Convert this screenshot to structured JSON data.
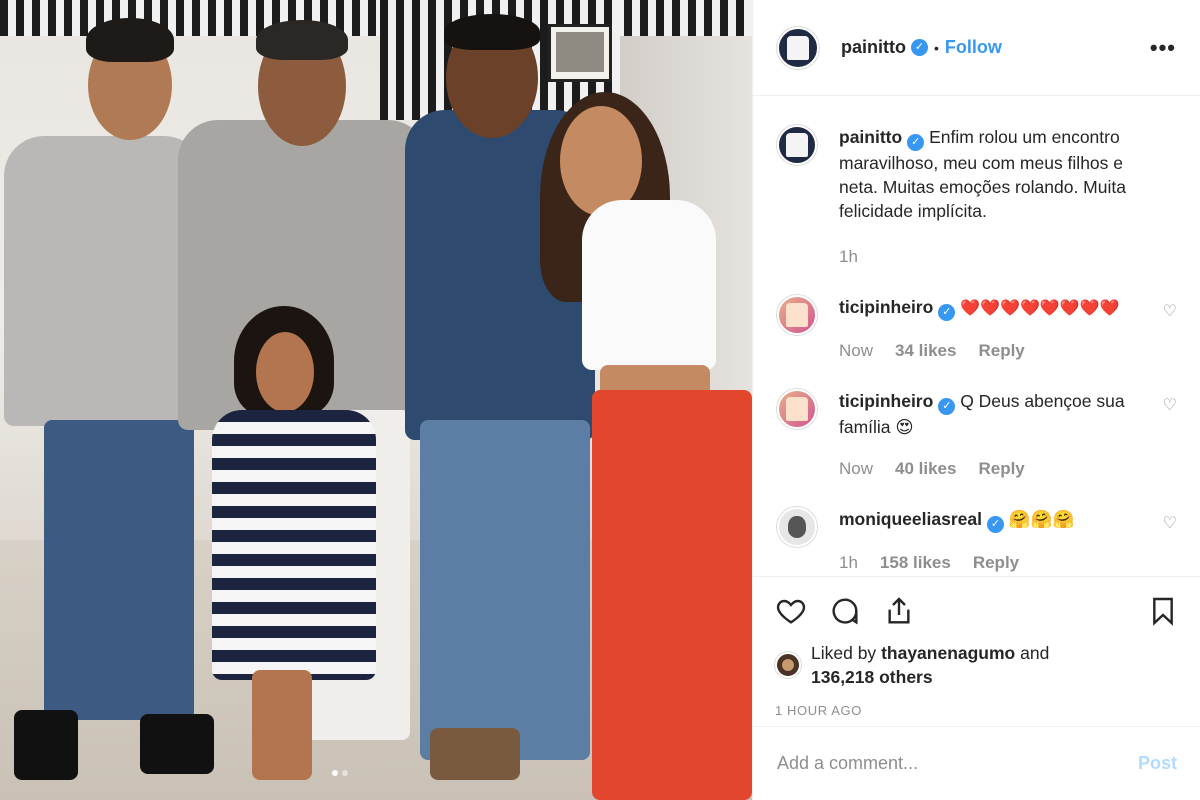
{
  "post": {
    "username": "painitto",
    "follow_label": "Follow",
    "bullet": "•",
    "more_label": "•••",
    "caption": "Enfim rolou um encontro maravilhoso, meu com meus filhos e neta. Muitas emoções rolando. Muita felicidade implícita.",
    "caption_time": "1h"
  },
  "comments": [
    {
      "username": "ticipinheiro",
      "text": "❤️❤️❤️❤️❤️❤️❤️❤️",
      "time": "Now",
      "likes": "34 likes",
      "reply": "Reply"
    },
    {
      "username": "ticipinheiro",
      "text": "Q Deus abençoe sua família 😍",
      "time": "Now",
      "likes": "40 likes",
      "reply": "Reply"
    },
    {
      "username": "moniqueeliasreal",
      "text": "🤗🤗🤗",
      "time": "1h",
      "likes": "158 likes",
      "reply": "Reply"
    }
  ],
  "likes": {
    "prefix": "Liked by",
    "user": "thayanenagumo",
    "connector": "and",
    "others": "136,218 others"
  },
  "timestamp": "1 HOUR AGO",
  "add_comment": {
    "placeholder": "Add a comment...",
    "post_label": "Post"
  },
  "colors": {
    "link_blue": "#3897f0",
    "post_disabled": "#b3dbff",
    "muted": "#8e8e8e",
    "text": "#262626"
  },
  "icons": [
    "heart-icon",
    "comment-icon",
    "share-icon",
    "bookmark-icon",
    "verified-badge-icon",
    "more-options-icon"
  ]
}
